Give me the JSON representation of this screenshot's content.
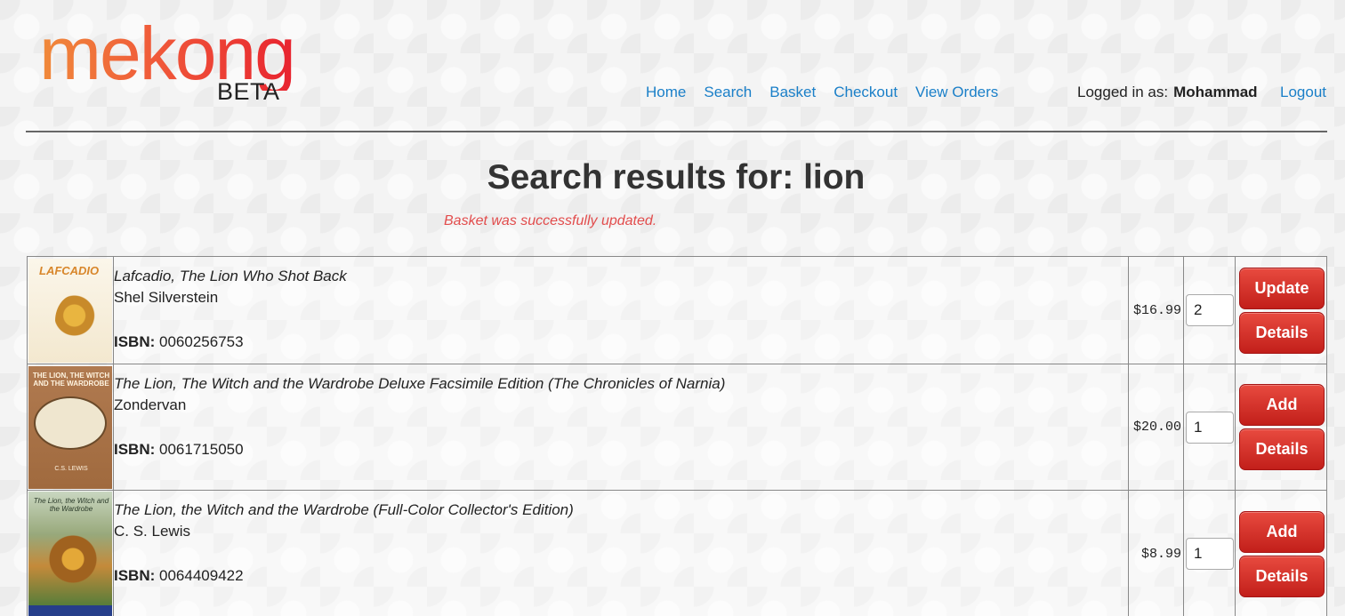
{
  "logo": {
    "word": "mekong",
    "sub": "BETA"
  },
  "nav": {
    "items": [
      "Home",
      "Search",
      "Basket",
      "Checkout",
      "View Orders"
    ]
  },
  "user": {
    "prefix": "Logged in as:",
    "name": "Mohammad",
    "logout": "Logout"
  },
  "page_title": "Search results for: lion",
  "flash": "Basket was successfully updated.",
  "isbn_label": "ISBN:",
  "results": [
    {
      "title": "Lafcadio, The Lion Who Shot Back",
      "author": "Shel Silverstein",
      "isbn": "0060256753",
      "price": "$16.99",
      "qty": "2",
      "primary_action": "Update",
      "secondary_action": "Details",
      "cover_text": "LAFCADIO"
    },
    {
      "title": "The Lion, The Witch and the Wardrobe Deluxe Facsimile Edition (The Chronicles of Narnia)",
      "author": "Zondervan",
      "isbn": "0061715050",
      "price": "$20.00",
      "qty": "1",
      "primary_action": "Add",
      "secondary_action": "Details",
      "cover_text": "THE LION, THE WITCH AND THE WARDROBE",
      "cover_author": "C.S. LEWIS"
    },
    {
      "title": "The Lion, the Witch and the Wardrobe (Full-Color Collector's Edition)",
      "author": "C. S. Lewis",
      "isbn": "0064409422",
      "price": "$8.99",
      "qty": "1",
      "primary_action": "Add",
      "secondary_action": "Details",
      "cover_text": "The Lion, the Witch and the Wardrobe"
    }
  ],
  "colors": {
    "link": "#1a7fc8",
    "button": "#d23a32",
    "flash": "#e24c4c"
  }
}
